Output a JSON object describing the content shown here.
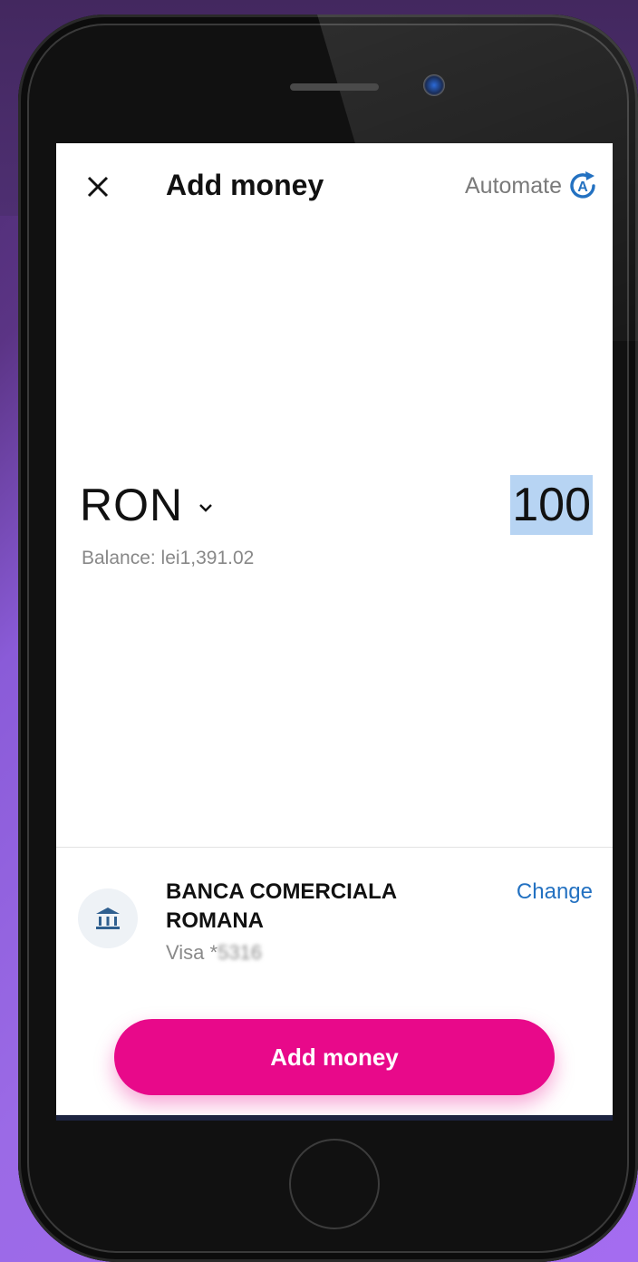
{
  "header": {
    "close_icon": "close-icon",
    "title": "Add money",
    "automate_label": "Automate",
    "automate_icon": "automate-icon"
  },
  "amount_section": {
    "currency": "RON",
    "amount": "100",
    "balance": "Balance: lei1,391.02"
  },
  "payment_source": {
    "bank_name": "BANCA COMERCIALA ROMANA",
    "card_label": "Visa *",
    "card_number_masked": "5316",
    "change_label": "Change",
    "bank_icon": "bank-icon"
  },
  "action": {
    "button_label": "Add money"
  },
  "colors": {
    "accent_pink": "#e8098a",
    "link_blue": "#2371c1",
    "selection_blue": "#b7d4f3"
  }
}
